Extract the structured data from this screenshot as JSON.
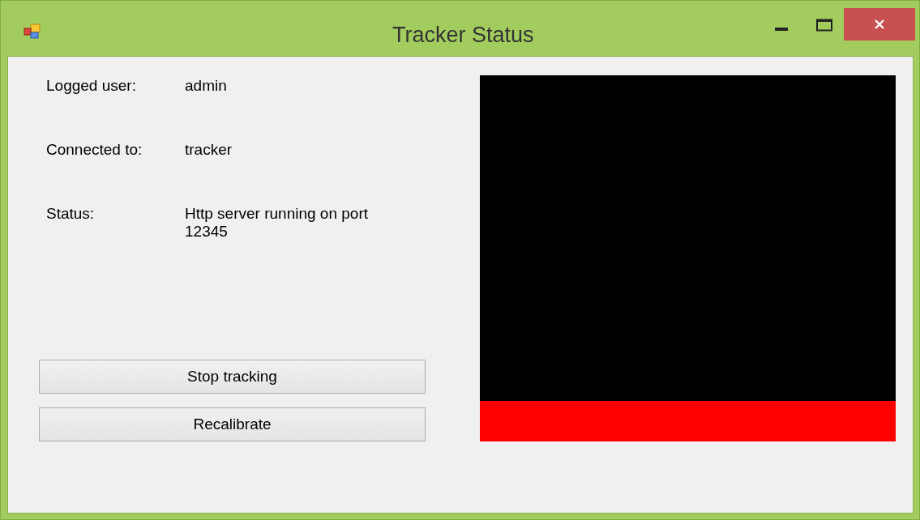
{
  "window": {
    "title": "Tracker Status"
  },
  "fields": [
    {
      "label": "Logged user:",
      "value": "admin"
    },
    {
      "label": "Connected to:",
      "value": "tracker"
    },
    {
      "label": "Status:",
      "value": "Http server running on port 12345"
    }
  ],
  "buttons": [
    "Stop tracking",
    "Recalibrate"
  ]
}
